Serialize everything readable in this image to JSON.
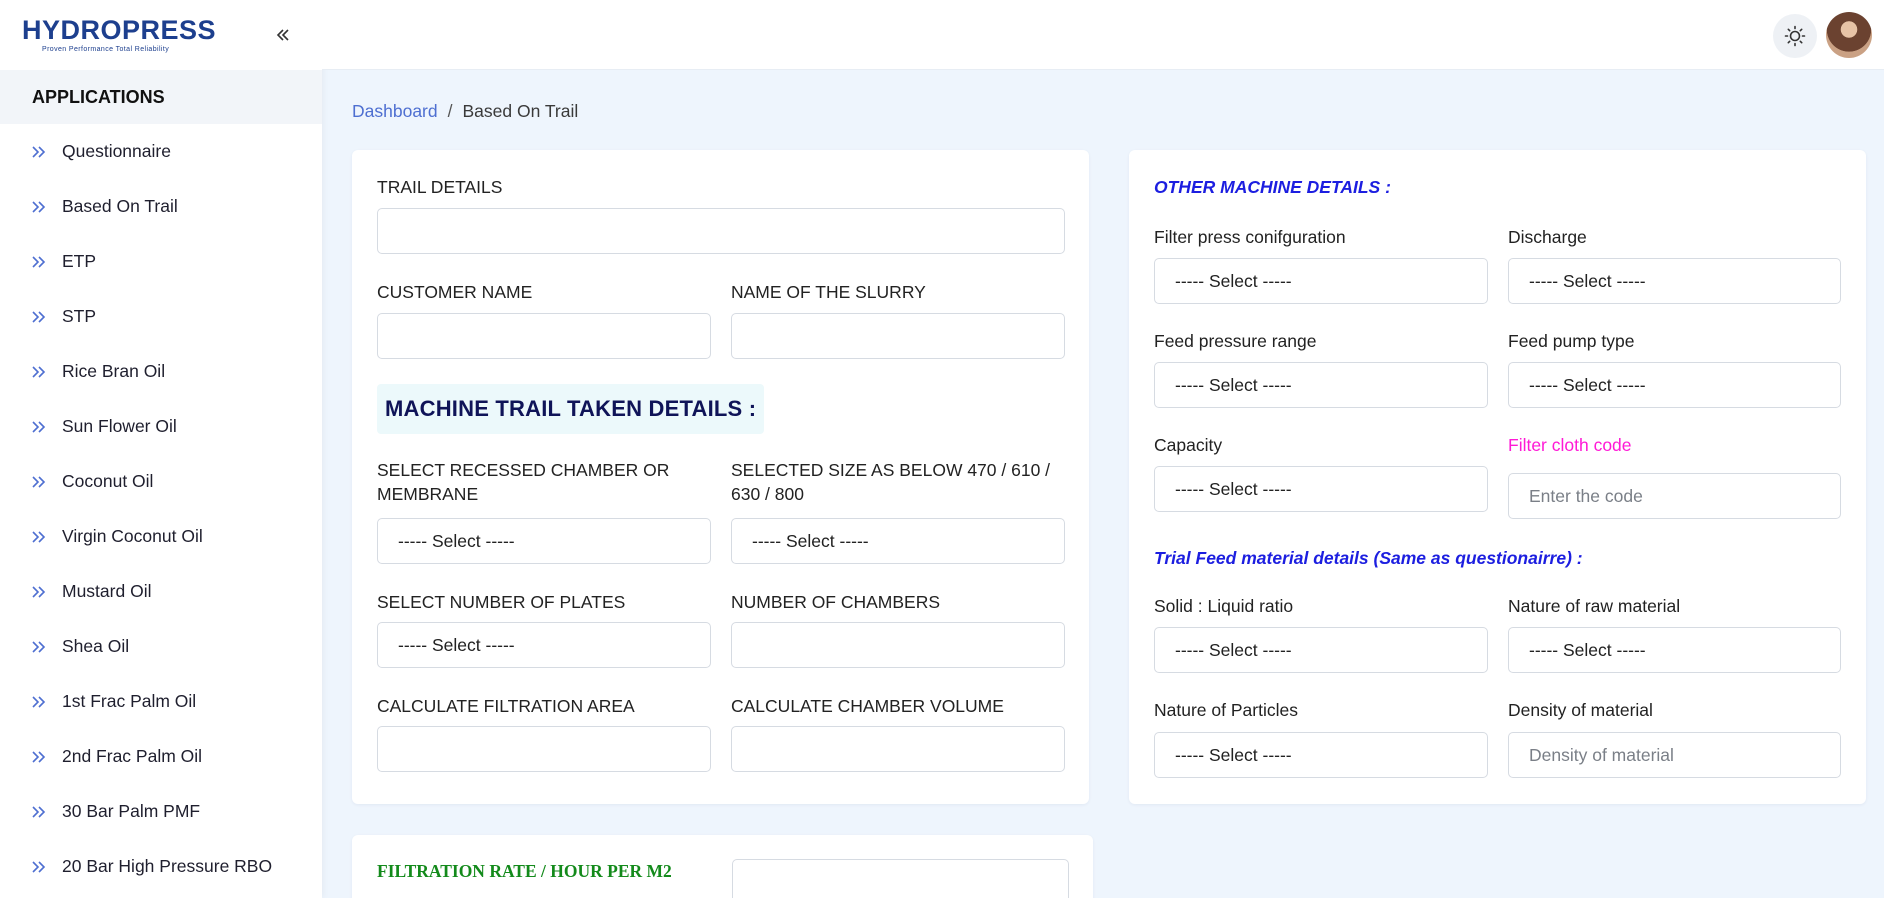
{
  "brand": {
    "logo_text": "HYDROPRESS",
    "tagline": "Proven Performance Total Reliability"
  },
  "sidebar": {
    "section": "APPLICATIONS",
    "items": [
      {
        "label": "Questionnaire"
      },
      {
        "label": "Based On Trail"
      },
      {
        "label": "ETP"
      },
      {
        "label": "STP"
      },
      {
        "label": "Rice Bran Oil"
      },
      {
        "label": "Sun Flower Oil"
      },
      {
        "label": "Coconut Oil"
      },
      {
        "label": "Virgin Coconut Oil"
      },
      {
        "label": "Mustard Oil"
      },
      {
        "label": "Shea Oil"
      },
      {
        "label": "1st Frac Palm Oil"
      },
      {
        "label": "2nd Frac Palm Oil"
      },
      {
        "label": "30 Bar Palm PMF"
      },
      {
        "label": "20 Bar High Pressure RBO"
      }
    ]
  },
  "breadcrumb": {
    "home": "Dashboard",
    "separator": "/",
    "current": "Based On Trail"
  },
  "left_card": {
    "trail_details_label": "TRAIL DETAILS",
    "trail_details_value": "",
    "customer_name_label": "CUSTOMER NAME",
    "customer_name_value": "",
    "slurry_label": "NAME OF THE SLURRY",
    "slurry_value": "",
    "machine_section_title": "MACHINE TRAIL TAKEN DETAILS :",
    "recessed_label": "SELECT RECESSED CHAMBER OR MEMBRANE",
    "recessed_value": "----- Select -----",
    "size_label": "SELECTED SIZE AS BELOW 470 / 610 / 630 / 800",
    "size_value": "----- Select -----",
    "plates_label": "SELECT NUMBER OF PLATES",
    "plates_value": "----- Select -----",
    "chambers_label": "NUMBER OF CHAMBERS",
    "chambers_value": "",
    "filtration_area_label": "CALCULATE FILTRATION AREA",
    "filtration_area_value": "",
    "chamber_volume_label": "CALCULATE CHAMBER VOLUME",
    "chamber_volume_value": ""
  },
  "right_card": {
    "other_title": "OTHER MACHINE DETAILS :",
    "config_label": "Filter press conifguration",
    "config_value": "----- Select -----",
    "discharge_label": "Discharge",
    "discharge_value": "----- Select -----",
    "feed_pressure_label": "Feed pressure range",
    "feed_pressure_value": "----- Select -----",
    "feed_pump_label": "Feed pump type",
    "feed_pump_value": "----- Select -----",
    "capacity_label": "Capacity",
    "capacity_value": "----- Select -----",
    "cloth_code_label": "Filter cloth code",
    "cloth_code_placeholder": "Enter the code",
    "trial_title": "Trial Feed material details (Same as questionairre) :",
    "solid_liquid_label": "Solid : Liquid ratio",
    "solid_liquid_value": "----- Select -----",
    "raw_material_label": "Nature of raw material",
    "raw_material_value": "----- Select -----",
    "particles_label": "Nature of Particles",
    "particles_value": "----- Select -----",
    "density_label": "Density of material",
    "density_placeholder": "Density of material"
  },
  "bottom_card": {
    "filtration_rate_label": "FILTRATION RATE / HOUR PER M2",
    "filtration_rate_value": ""
  },
  "colors": {
    "accent_blue": "#4e6fd1",
    "section_blue": "#1c1ee0",
    "pink": "#ff1ad6",
    "green": "#138a1b",
    "navy": "#0f1458"
  }
}
